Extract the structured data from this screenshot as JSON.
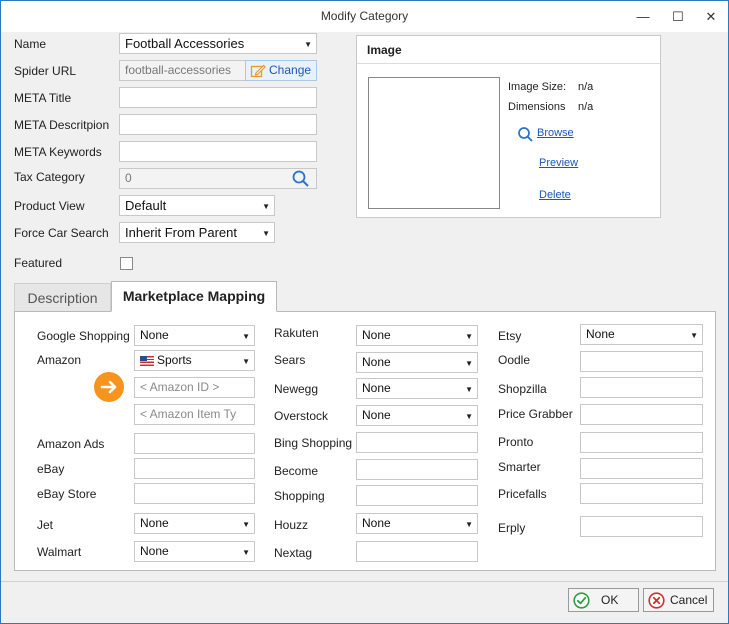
{
  "window": {
    "title": "Modify Category",
    "minimize_glyph": "—",
    "maximize_glyph": "☐",
    "close_glyph": "✕"
  },
  "form": {
    "name_label": "Name",
    "name_value": "Football Accessories",
    "spider_url_label": "Spider URL",
    "spider_url_value": "football-accessories",
    "change_label": "Change",
    "meta_title_label": "META Title",
    "meta_title_value": "",
    "meta_description_label": "META Descritpion",
    "meta_description_value": "",
    "meta_keywords_label": "META Keywords",
    "meta_keywords_value": "",
    "tax_category_label": "Tax Category",
    "tax_category_value": "0",
    "product_view_label": "Product View",
    "product_view_value": "Default",
    "force_car_search_label": "Force Car Search",
    "force_car_search_value": "Inherit From Parent",
    "featured_label": "Featured",
    "featured_checked": false
  },
  "image_panel": {
    "header": "Image",
    "image_size_label": "Image Size:",
    "image_size_value": "n/a",
    "dimensions_label": "Dimensions",
    "dimensions_value": "n/a",
    "browse_label": "Browse",
    "preview_label": "Preview",
    "delete_label": "Delete"
  },
  "tabs": [
    {
      "label": "Description",
      "active": false
    },
    {
      "label": "Marketplace Mapping",
      "active": true
    }
  ],
  "marketplace": {
    "google_shopping_label": "Google Shopping",
    "google_shopping_value": "None",
    "amazon_label": "Amazon",
    "amazon_value": "Sports",
    "amazon_id_placeholder": "< Amazon ID >",
    "amazon_item_type_placeholder": "< Amazon Item Ty",
    "amazon_ads_label": "Amazon Ads",
    "ebay_label": "eBay",
    "ebay_store_label": "eBay Store",
    "jet_label": "Jet",
    "jet_value": "None",
    "walmart_label": "Walmart",
    "walmart_value": "None",
    "rakuten_label": "Rakuten",
    "rakuten_value": "None",
    "sears_label": "Sears",
    "sears_value": "None",
    "newegg_label": "Newegg",
    "newegg_value": "None",
    "overstock_label": "Overstock",
    "overstock_value": "None",
    "bing_shopping_label": "Bing Shopping",
    "become_label": "Become",
    "shopping_label": "Shopping",
    "houzz_label": "Houzz",
    "houzz_value": "None",
    "nextag_label": "Nextag",
    "etsy_label": "Etsy",
    "etsy_value": "None",
    "oodle_label": "Oodle",
    "shopzilla_label": "Shopzilla",
    "price_grabber_label": "Price Grabber",
    "pronto_label": "Pronto",
    "smarter_label": "Smarter",
    "pricefalls_label": "Pricefalls",
    "erply_label": "Erply"
  },
  "footer": {
    "ok_label": "OK",
    "cancel_label": "Cancel"
  },
  "colors": {
    "link_blue": "#1a57b8",
    "orange_hint": "#f7941d",
    "ok_green": "#2e9e3e",
    "cancel_red": "#d32f2f",
    "window_border": "#2b79c2"
  }
}
